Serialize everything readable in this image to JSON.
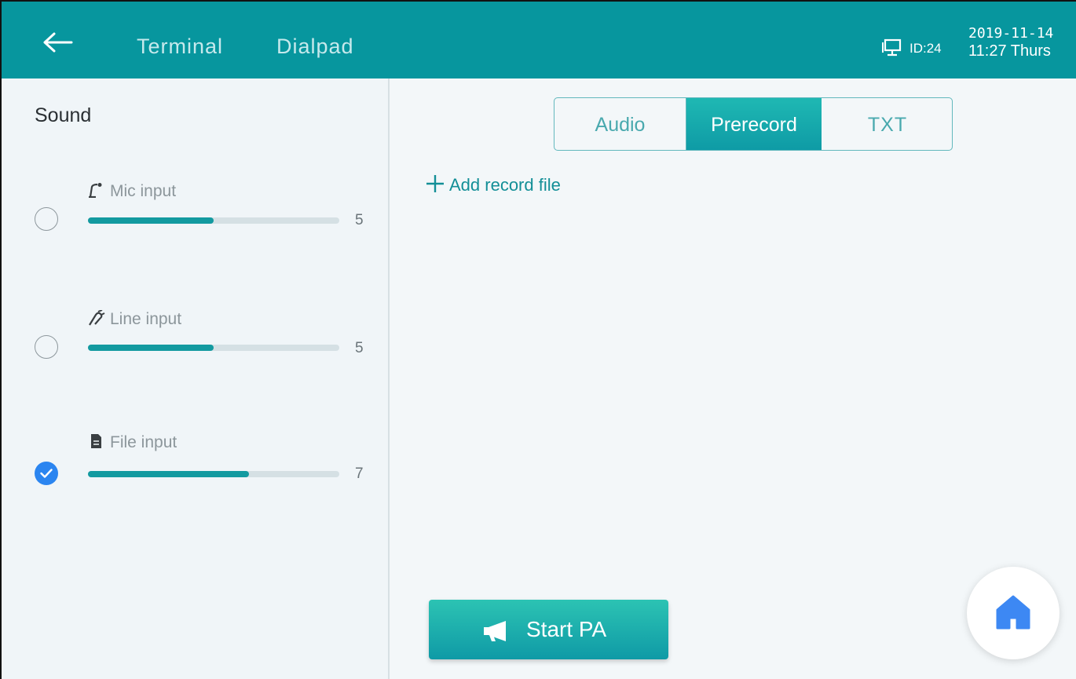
{
  "topbar": {
    "nav": [
      "Terminal",
      "Dialpad"
    ],
    "device_id": "ID:24",
    "date": "2019-11-14",
    "time": "11:27 Thurs",
    "icons": [
      "back-arrow-icon",
      "monitor-icon"
    ]
  },
  "sound": {
    "title": "Sound",
    "inputs": [
      {
        "label": "Mic input",
        "icon": "microphone-icon",
        "level": 5,
        "level_fraction": 0.5,
        "selected": false
      },
      {
        "label": "Line input",
        "icon": "line-plug-icon",
        "level": 5,
        "level_fraction": 0.5,
        "selected": false
      },
      {
        "label": "File input",
        "icon": "file-icon",
        "level": 7,
        "level_fraction": 0.64,
        "selected": true
      }
    ]
  },
  "tabs": {
    "items": [
      "Audio",
      "Prerecord",
      "TXT"
    ],
    "active": "Prerecord"
  },
  "prerecord": {
    "add_label": "Add record file"
  },
  "actions": {
    "start_pa": "Start PA",
    "start_pa_icon": "megaphone-icon",
    "home_icon": "home-icon"
  },
  "colors": {
    "header": "#07969e",
    "accent": "#139aa0",
    "check": "#2b85f0",
    "home": "#3d88f3"
  }
}
